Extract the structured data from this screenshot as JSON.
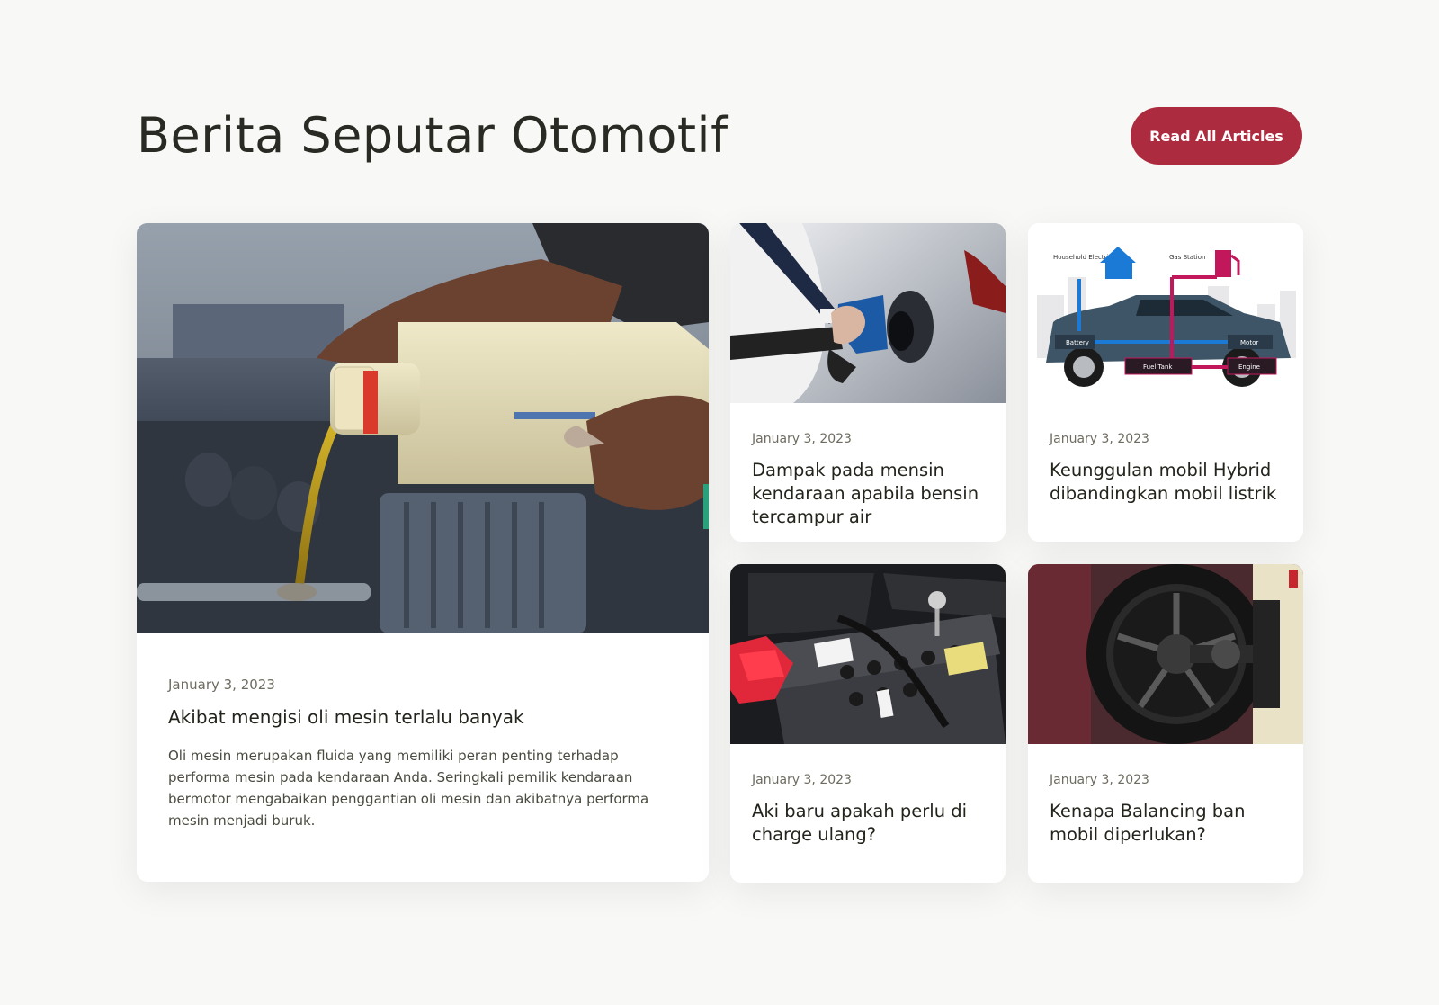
{
  "header": {
    "title": "Berita Seputar Otomotif",
    "read_all_label": "Read All Articles",
    "accent_color": "#ad2b3f"
  },
  "featured": {
    "image": "engine-oil-pouring-image",
    "date": "January 3, 2023",
    "title": "Akibat mengisi oli mesin terlalu banyak",
    "excerpt": "Oli mesin merupakan fluida yang memiliki peran penting terhadap performa mesin pada kendaraan Anda. Seringkali pemilik kendaraan bermotor mengabaikan penggantian oli mesin dan akibatnya performa mesin menjadi buruk."
  },
  "articles": [
    {
      "image": "fuel-nozzle-refueling-image",
      "date": "January 3, 2023",
      "title": "Dampak pada mensin kendaraan apabila bensin tercampur air"
    },
    {
      "image": "hybrid-car-diagram-image",
      "date": "January 3, 2023",
      "title": "Keunggulan mobil Hybrid dibandingkan mobil listrik",
      "diagram_labels": {
        "household": "Household Electricity",
        "gas": "Gas Station",
        "battery": "Battery",
        "motor": "Motor",
        "fuel_tank": "Fuel Tank",
        "engine": "Engine"
      }
    },
    {
      "image": "car-battery-image",
      "date": "January 3, 2023",
      "title": "Aki baru apakah perlu di charge ulang?"
    },
    {
      "image": "wheel-balancing-image",
      "date": "January 3, 2023",
      "title": "Kenapa Balancing ban mobil diperlukan?"
    }
  ]
}
